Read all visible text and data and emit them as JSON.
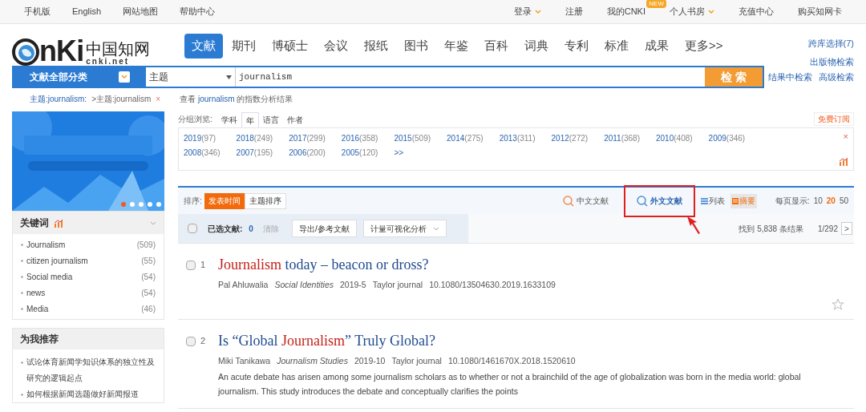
{
  "top_bar": {
    "left": [
      "手机版",
      "English",
      "网站地图",
      "帮助中心"
    ],
    "right": [
      {
        "label": "登录",
        "dropdown": true
      },
      {
        "label": "注册",
        "dropdown": false
      },
      {
        "label": "我的CNKI",
        "dropdown": false,
        "badge": "NEW"
      },
      {
        "label": "个人书房",
        "dropdown": true
      },
      {
        "label": "充值中心",
        "dropdown": false
      },
      {
        "label": "购买知网卡",
        "dropdown": false
      }
    ]
  },
  "logo": {
    "mark": "nKi",
    "name": "中国知网",
    "domain": "cnki.net"
  },
  "nav_tabs": [
    {
      "label": "文献",
      "selected": true
    },
    {
      "label": "期刊",
      "selected": false
    },
    {
      "label": "博硕士",
      "selected": false
    },
    {
      "label": "会议",
      "selected": false
    },
    {
      "label": "报纸",
      "selected": false
    },
    {
      "label": "图书",
      "selected": false
    },
    {
      "label": "年鉴",
      "selected": false
    },
    {
      "label": "百科",
      "selected": false
    },
    {
      "label": "词典",
      "selected": false
    },
    {
      "label": "专利",
      "selected": false
    },
    {
      "label": "标准",
      "selected": false
    },
    {
      "label": "成果",
      "selected": false
    },
    {
      "label": "更多>>",
      "selected": false
    }
  ],
  "search": {
    "category": "文献全部分类",
    "field": "主题",
    "value": "journalism",
    "button": "检 索"
  },
  "side_links": [
    "跨库选择(7)",
    "出版物检索",
    "结果中检索",
    "高级检索"
  ],
  "breadcrumb": {
    "items": [
      "主题:journalism:",
      ">主题:journalism"
    ],
    "close": "×",
    "analysis_prefix": "查看",
    "analysis_term": "journalism",
    "analysis_suffix": "的指数分析结果"
  },
  "banner": {
    "kind": "picture"
  },
  "keywords": {
    "title": "关键词",
    "items": [
      {
        "label": "Journalism",
        "count": "(509)"
      },
      {
        "label": "citizen journalism",
        "count": "(55)"
      },
      {
        "label": "Social media",
        "count": "(54)"
      },
      {
        "label": "news",
        "count": "(54)"
      },
      {
        "label": "Media",
        "count": "(46)"
      }
    ]
  },
  "recommend": {
    "title": "为我推荐",
    "items": [
      "试论体育新闻学知识体系的独立性及研究的逻辑起点",
      "如何根据新闻选题做好新闻报道"
    ]
  },
  "grouping": {
    "label": "分组浏览:",
    "tabs": [
      {
        "label": "学科",
        "selected": false
      },
      {
        "label": "年",
        "selected": true
      },
      {
        "label": "语言",
        "selected": false
      },
      {
        "label": "作者",
        "selected": false
      }
    ],
    "subscribe": "免费订阅",
    "close": "×",
    "years": [
      {
        "year": "2019",
        "count": "(97)"
      },
      {
        "year": "2018",
        "count": "(249)"
      },
      {
        "year": "2017",
        "count": "(299)"
      },
      {
        "year": "2016",
        "count": "(358)"
      },
      {
        "year": "2015",
        "count": "(509)"
      },
      {
        "year": "2014",
        "count": "(275)"
      },
      {
        "year": "2013",
        "count": "(311)"
      },
      {
        "year": "2012",
        "count": "(272)"
      },
      {
        "year": "2011",
        "count": "(368)"
      },
      {
        "year": "2010",
        "count": "(408)"
      },
      {
        "year": "2009",
        "count": "(346)"
      },
      {
        "year": "2008",
        "count": "(346)"
      },
      {
        "year": "2007",
        "count": "(195)"
      },
      {
        "year": "2006",
        "count": "(200)"
      },
      {
        "year": "2005",
        "count": "(120)"
      }
    ],
    "more": ">>"
  },
  "sort": {
    "label": "排序:",
    "options": [
      {
        "label": "发表时间",
        "selected": true
      },
      {
        "label": "主题排序",
        "selected": false
      }
    ],
    "languages": [
      {
        "label": "中文文献",
        "selected": false
      },
      {
        "label": "外文文献",
        "selected": true
      }
    ],
    "views": [
      {
        "label": "列表",
        "selected": false
      },
      {
        "label": "摘要",
        "selected": true
      }
    ],
    "per_page_label": "每页显示:",
    "per_page": [
      {
        "label": "10",
        "selected": false
      },
      {
        "label": "20",
        "selected": true
      },
      {
        "label": "50",
        "selected": false
      }
    ]
  },
  "selection": {
    "checked": false,
    "label": "已选文献:",
    "count": "0",
    "clear": "清除",
    "export": "导出/参考文献",
    "visualize": "计量可视化分析",
    "found": "找到 5,838 条结果",
    "page": "1/292",
    "next": ">"
  },
  "results": [
    {
      "number": "1",
      "checked": false,
      "starred": false,
      "title": [
        {
          "text": "Journalism",
          "highlight": true
        },
        {
          "text": " today – beacon or dross?",
          "highlight": false
        }
      ],
      "author": "Pal Ahluwalia",
      "journal": "Social Identities",
      "date": "2019-5",
      "publisher": "Taylor journal",
      "doi": "10.1080/13504630.2019.1633109"
    },
    {
      "number": "2",
      "checked": false,
      "title": [
        {
          "text": "Is “Global ",
          "highlight": false
        },
        {
          "text": "Journalism",
          "highlight": true
        },
        {
          "text": "” Truly Global?",
          "highlight": false
        }
      ],
      "author": "Miki Tanikawa",
      "journal": "Journalism Studies",
      "date": "2019-10",
      "publisher": "Taylor journal",
      "doi": "10.1080/1461670X.2018.1520610",
      "abstract": "An acute debate has arisen among some journalism scholars as to whether or not a brainchild of the age of globalization was born in the media world: global journalism. This study introduces the debate and conceptually clarifies the points"
    }
  ]
}
